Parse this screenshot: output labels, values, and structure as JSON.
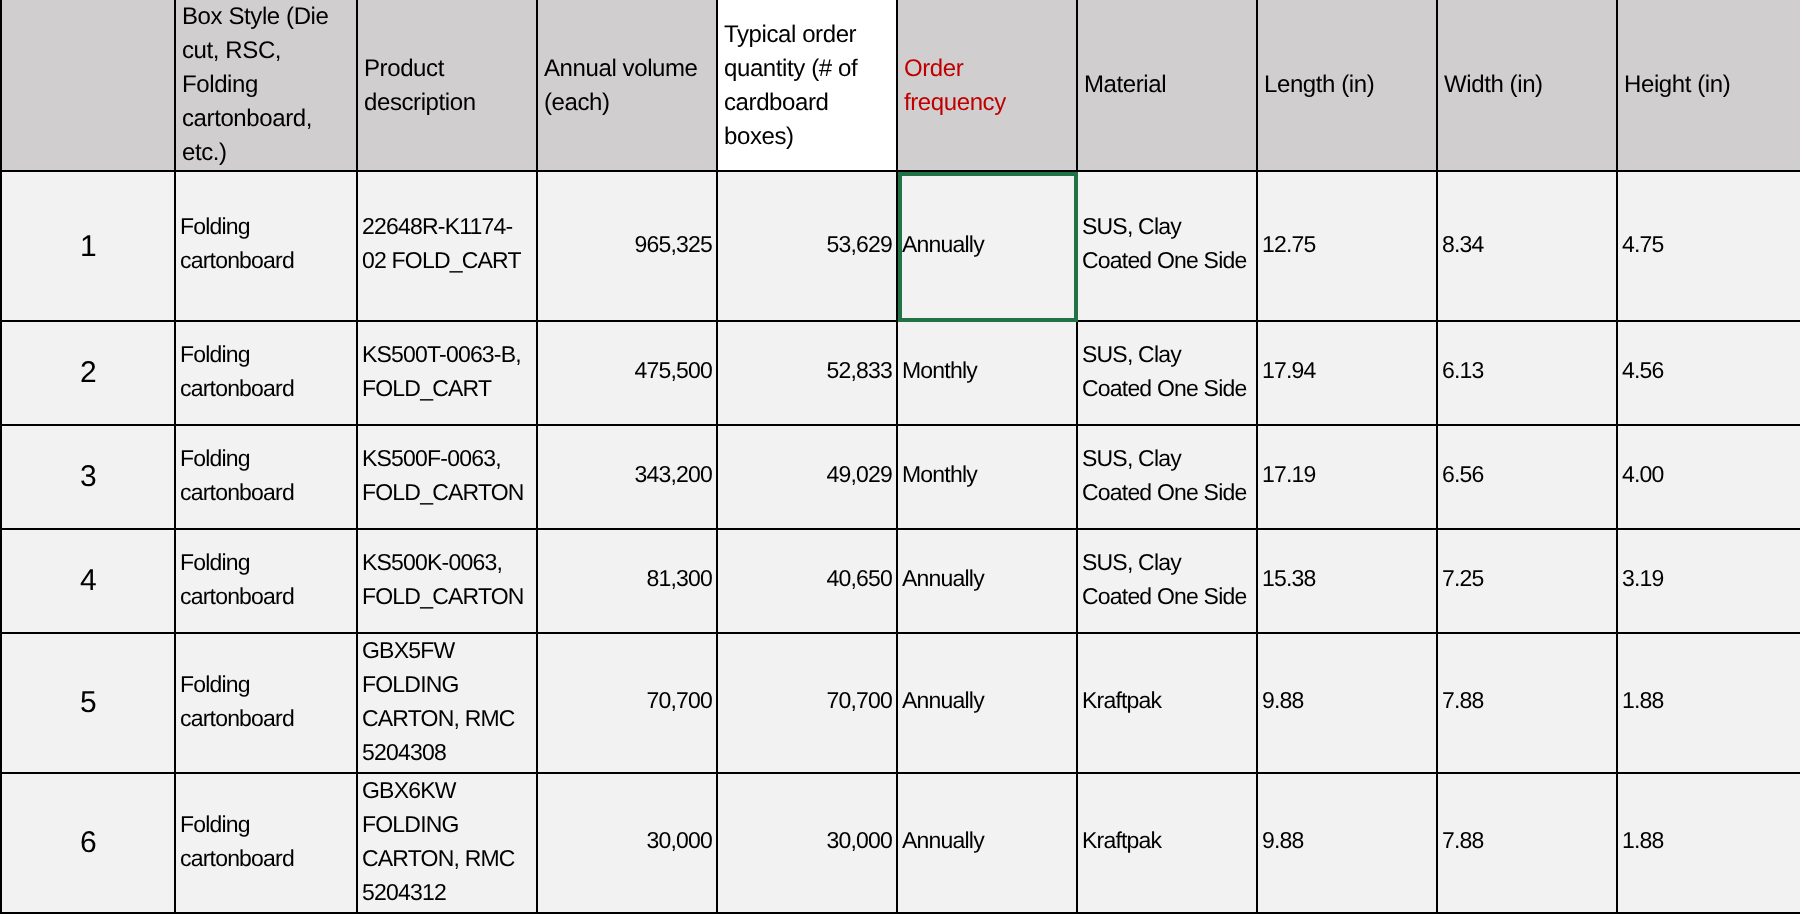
{
  "table": {
    "columns": [
      {
        "shaded": true
      },
      {
        "label": "Box Style (Die cut, RSC, Folding cartonboard, etc.)",
        "shaded": true
      },
      {
        "label": "Product description",
        "shaded": true
      },
      {
        "label": "Annual volume (each)",
        "shaded": true
      },
      {
        "label": "Typical order quantity (# of cardboard boxes)",
        "shaded": false
      },
      {
        "label": "Order frequency",
        "shaded": true,
        "color": "#c00000"
      },
      {
        "label": "Material",
        "shaded": true
      },
      {
        "label": "Length (in)",
        "shaded": true
      },
      {
        "label": "Width (in)",
        "shaded": true
      },
      {
        "label": "Height (in)",
        "shaded": true
      }
    ],
    "rows": [
      {
        "cells": [
          "1",
          "Folding cartonboard",
          "22648R-K1174-02 FOLD_CART",
          "965,325",
          "53,629",
          "Annually",
          "SUS, Clay Coated One Side",
          "12.75",
          "8.34",
          "4.75"
        ],
        "selected_cell": [
          false,
          false,
          false,
          false,
          false,
          true,
          false,
          false,
          false,
          false
        ]
      },
      {
        "cells": [
          "2",
          "Folding cartonboard",
          "KS500T-0063-B, FOLD_CART",
          "475,500",
          "52,833",
          "Monthly",
          "SUS, Clay Coated One Side",
          "17.94",
          "6.13",
          "4.56"
        ],
        "selected_cell": [
          false,
          false,
          false,
          false,
          false,
          false,
          false,
          false,
          false,
          false
        ]
      },
      {
        "cells": [
          "3",
          "Folding cartonboard",
          "KS500F-0063, FOLD_CARTON",
          "343,200",
          "49,029",
          "Monthly",
          "SUS, Clay Coated One Side",
          "17.19",
          "6.56",
          "4.00"
        ],
        "selected_cell": [
          false,
          false,
          false,
          false,
          false,
          false,
          false,
          false,
          false,
          false
        ]
      },
      {
        "cells": [
          "4",
          "Folding cartonboard",
          "KS500K-0063, FOLD_CARTON",
          "81,300",
          "40,650",
          "Annually",
          "SUS, Clay Coated One Side",
          "15.38",
          "7.25",
          "3.19"
        ],
        "selected_cell": [
          false,
          false,
          false,
          false,
          false,
          false,
          false,
          false,
          false,
          false
        ]
      },
      {
        "cells": [
          "5",
          "Folding cartonboard",
          "GBX5FW FOLDING CARTON, RMC 5204308",
          "70,700",
          "70,700",
          "Annually",
          "Kraftpak",
          "9.88",
          "7.88",
          "1.88"
        ],
        "selected_cell": [
          false,
          false,
          false,
          false,
          false,
          false,
          false,
          false,
          false,
          false
        ]
      },
      {
        "cells": [
          "6",
          "Folding cartonboard",
          "GBX6KW FOLDING CARTON, RMC 5204312",
          "30,000",
          "30,000",
          "Annually",
          "Kraftpak",
          "9.88",
          "7.88",
          "1.88"
        ],
        "selected_cell": [
          false,
          false,
          false,
          false,
          false,
          false,
          false,
          false,
          false,
          false
        ]
      }
    ]
  }
}
